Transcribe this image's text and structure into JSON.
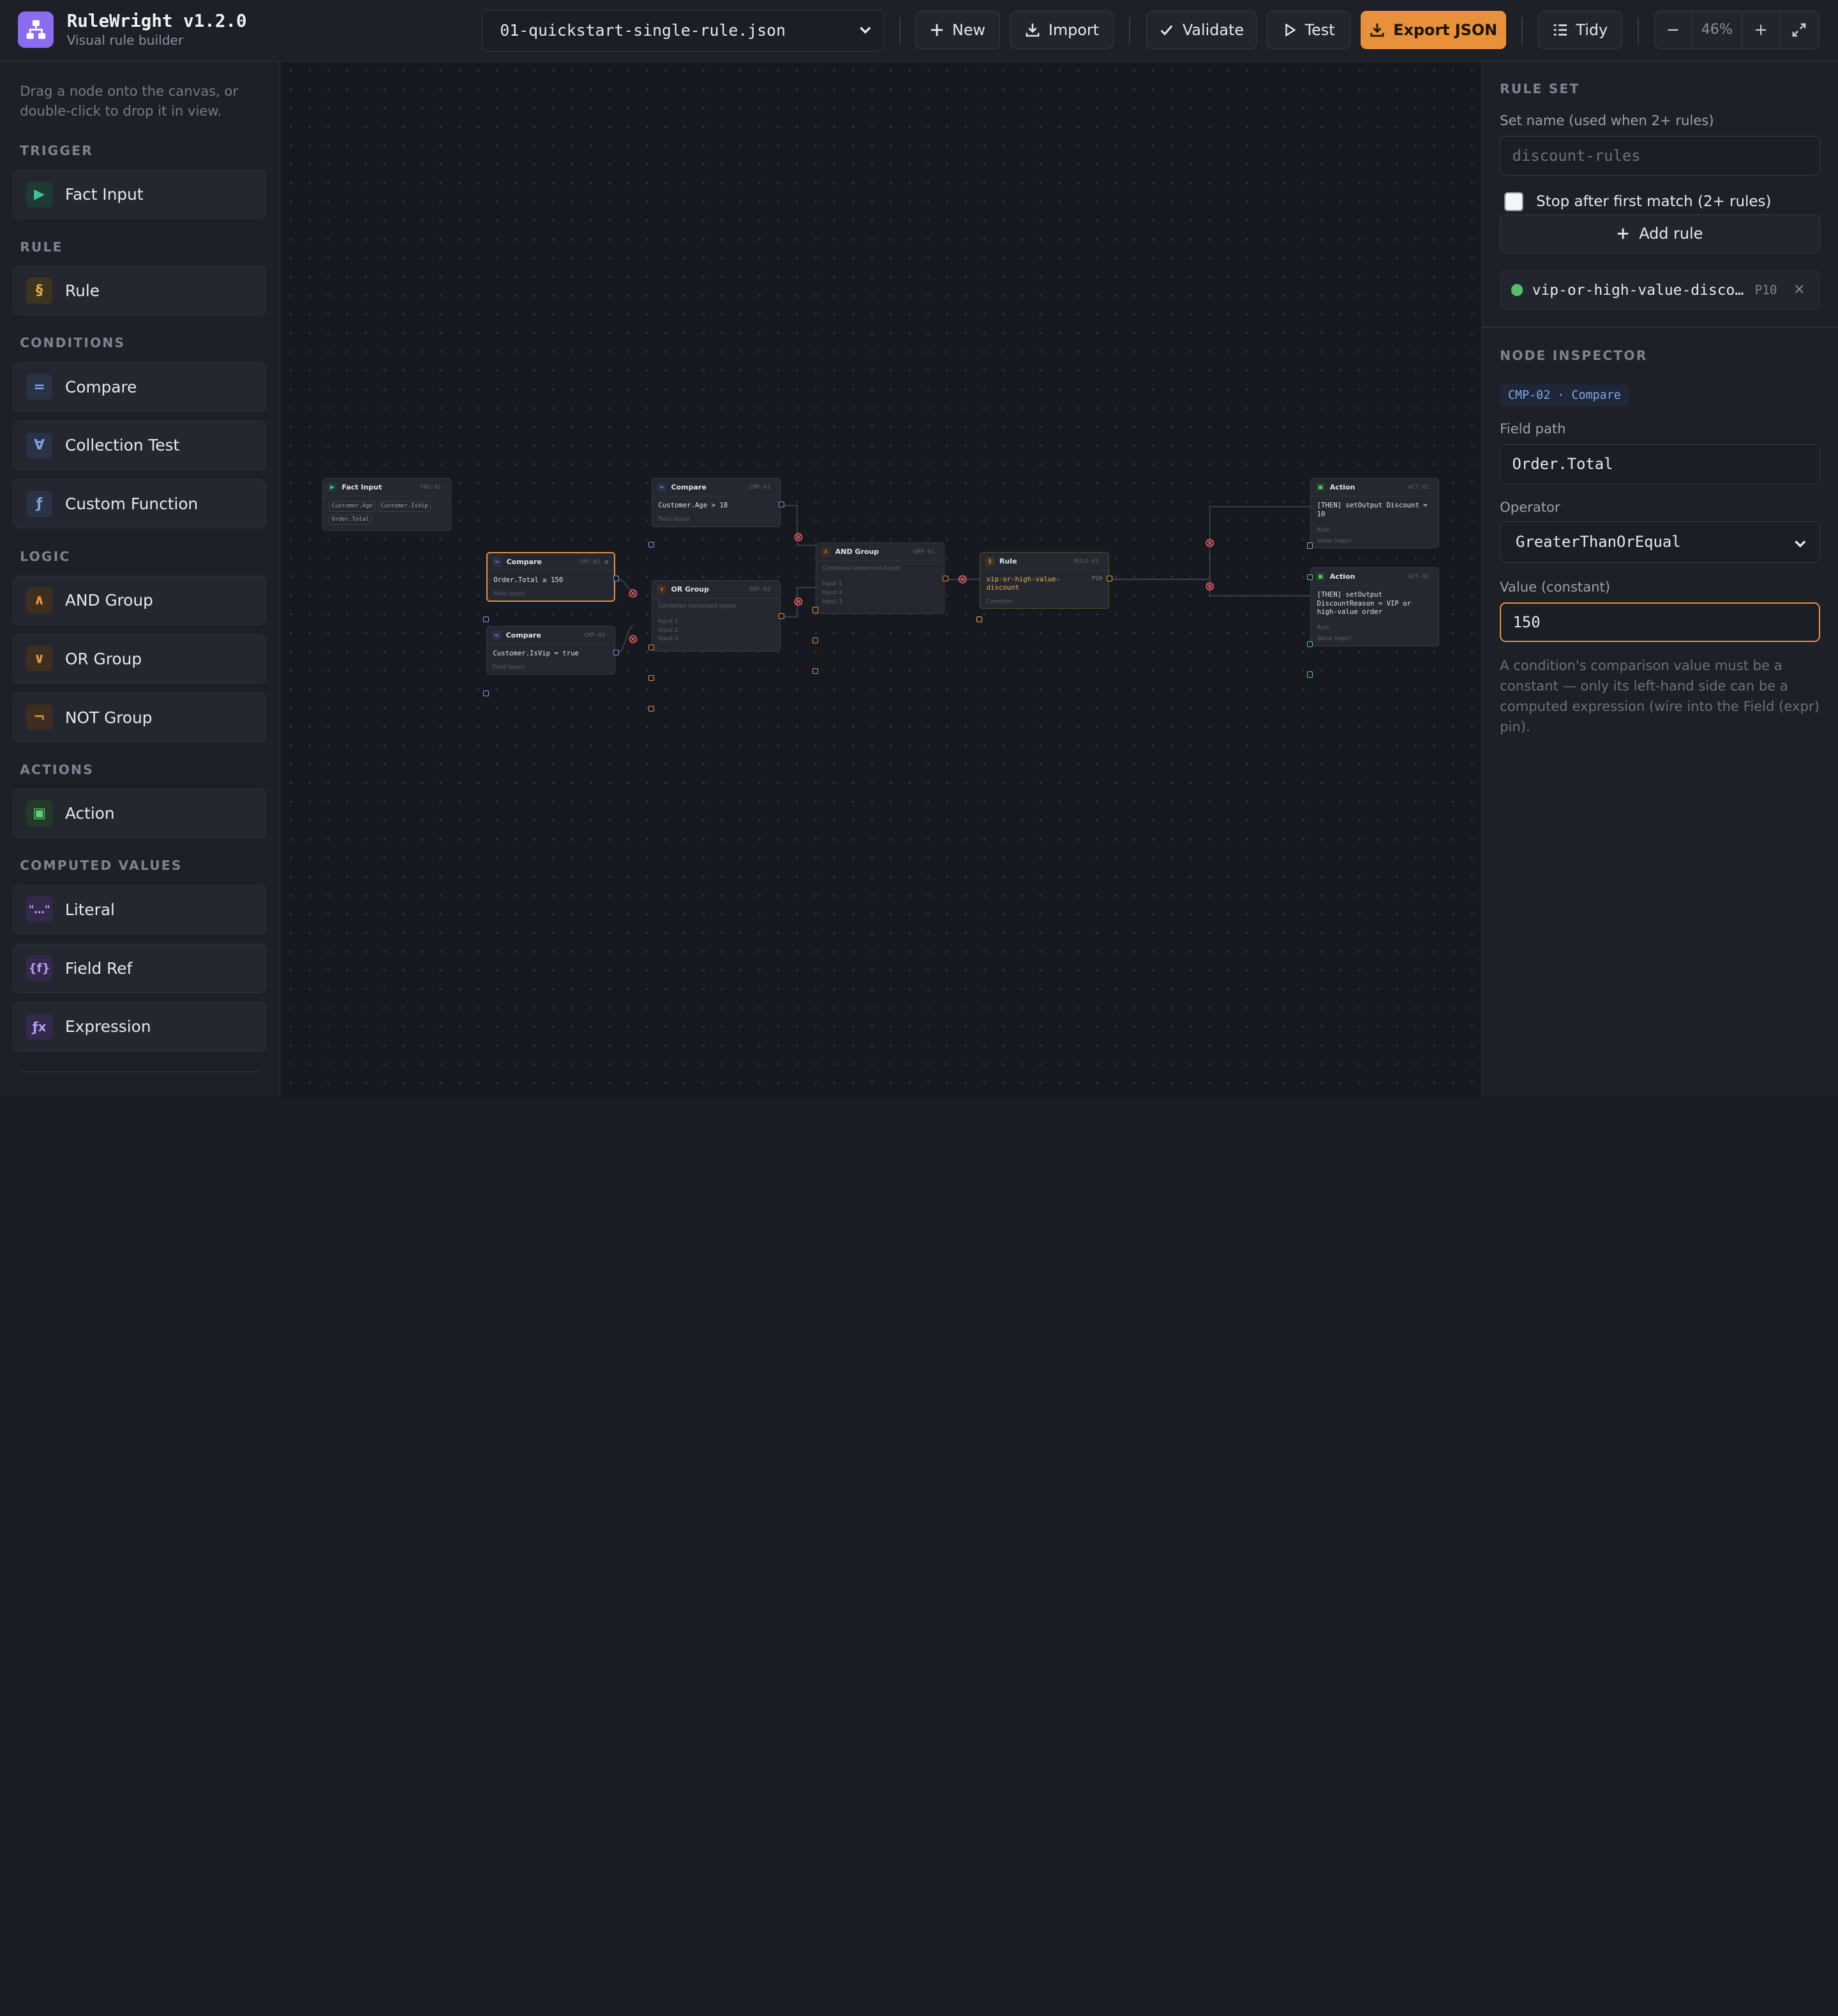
{
  "app": {
    "title": "RuleWright v1.2.0",
    "subtitle": "Visual rule builder"
  },
  "toolbar": {
    "file": "01-quickstart-single-rule.json",
    "new_label": "New",
    "import_label": "Import",
    "validate_label": "Validate",
    "test_label": "Test",
    "export_label": "Export JSON",
    "tidy_label": "Tidy",
    "zoom_level": "46%",
    "zoom_out_label": "−",
    "zoom_in_label": "+"
  },
  "sidebar": {
    "hint": "Drag a node onto the canvas, or double-click to drop it in view.",
    "sections": {
      "trigger": "TRIGGER",
      "rule": "RULE",
      "conditions": "CONDITIONS",
      "logic": "LOGIC",
      "actions": "ACTIONS",
      "computed": "COMPUTED VALUES"
    },
    "items": {
      "fact_input": {
        "label": "Fact Input",
        "glyph": "▶",
        "color": "#3fbf9f"
      },
      "rule": {
        "label": "Rule",
        "glyph": "§",
        "color": "#e0b040"
      },
      "compare": {
        "label": "Compare",
        "glyph": "=",
        "color": "#7fa0e0"
      },
      "collection_test": {
        "label": "Collection Test",
        "glyph": "∀",
        "color": "#7fa0e0"
      },
      "custom_function": {
        "label": "Custom Function",
        "glyph": "ƒ",
        "color": "#7fa0e0"
      },
      "and_group": {
        "label": "AND Group",
        "glyph": "∧",
        "color": "#e8913a"
      },
      "or_group": {
        "label": "OR Group",
        "glyph": "∨",
        "color": "#e8913a"
      },
      "not_group": {
        "label": "NOT Group",
        "glyph": "¬",
        "color": "#e8913a"
      },
      "action": {
        "label": "Action",
        "glyph": "▣",
        "color": "#5fcf6f"
      },
      "literal": {
        "label": "Literal",
        "glyph": "\"…\"",
        "color": "#b79af0"
      },
      "field_ref": {
        "label": "Field Ref",
        "glyph": "{f}",
        "color": "#b79af0"
      },
      "expression": {
        "label": "Expression",
        "glyph": "ƒx",
        "color": "#b79af0"
      }
    }
  },
  "canvas": {
    "nodes": {
      "fact": {
        "title": "Fact Input",
        "id": "TRG-01",
        "chips": [
          "Customer.Age",
          "Customer.IsVip",
          "Order.Total"
        ]
      },
      "cmp1": {
        "title": "Compare",
        "id": "CMP-01",
        "expr": "Customer.Age > 18",
        "foot": "Field (expr)"
      },
      "cmp2": {
        "title": "Compare",
        "id": "CMP-02",
        "expr": "Order.Total ≥ 150",
        "foot": "Field (expr)"
      },
      "cmp3": {
        "title": "Compare",
        "id": "CMP-03",
        "expr": "Customer.IsVip = true",
        "foot": "Field (expr)"
      },
      "or": {
        "title": "OR Group",
        "id": "GRP-02",
        "desc": "Combines connected inputs",
        "inputs": [
          "Input 1",
          "Input 2",
          "Input 3"
        ]
      },
      "and": {
        "title": "AND Group",
        "id": "GRP-01",
        "desc": "Combines connected inputs",
        "inputs": [
          "Input 1",
          "Input 2",
          "Input 3"
        ]
      },
      "rule": {
        "title": "Rule",
        "id": "RULE-01",
        "name": "vip-or-high-value-discount",
        "prio": "P10",
        "foot": "Condition"
      },
      "act1": {
        "title": "Action",
        "id": "ACT-01",
        "expr": "[THEN] setOutput Discount = 10",
        "foot1": "Rule",
        "foot2": "Value (expr)"
      },
      "act2": {
        "title": "Action",
        "id": "ACT-02",
        "expr": "[THEN] setOutput DiscountReason = VIP or high-value order",
        "foot1": "Rule",
        "foot2": "Value (expr)"
      }
    }
  },
  "rule_set": {
    "heading": "RULE SET",
    "set_name_label": "Set name (used when 2+ rules)",
    "set_name_placeholder": "discount-rules",
    "stop_label": "Stop after first match (2+ rules)",
    "stop_checked": false,
    "add_rule_label": "Add rule",
    "rules": [
      {
        "name": "vip-or-high-value-discount",
        "priority": "P10",
        "status_color": "#4fc26b"
      }
    ]
  },
  "inspector": {
    "heading": "NODE INSPECTOR",
    "badge": "CMP-02 · Compare",
    "field_path_label": "Field path",
    "field_path": "Order.Total",
    "operator_label": "Operator",
    "operator": "GreaterThanOrEqual",
    "value_label": "Value (constant)",
    "value": "150",
    "help": "A condition's comparison value must be a constant — only its left-hand side can be a computed expression (wire into the Field (expr) pin)."
  }
}
